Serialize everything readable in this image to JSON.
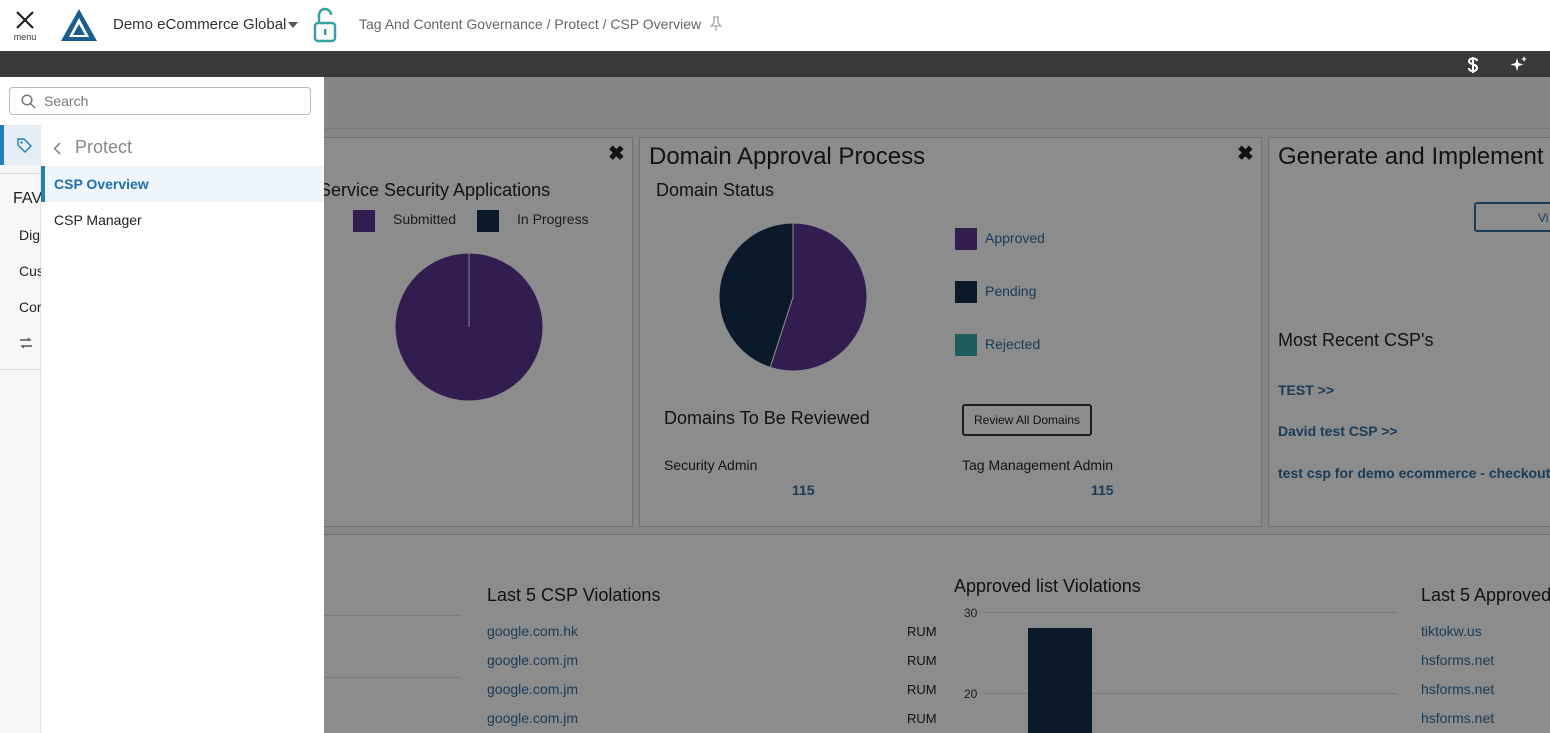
{
  "topbar": {
    "menu_label": "menu",
    "org_name": "Demo eCommerce Global",
    "breadcrumb": "Tag And Content Governance / Protect / CSP Overview"
  },
  "search": {
    "placeholder": "Search"
  },
  "sidebar": {
    "back_label": "Protect",
    "items": [
      {
        "label": "CSP Overview",
        "active": true
      },
      {
        "label": "CSP Manager",
        "active": false
      }
    ],
    "rail": {
      "fav_label": "FAV",
      "items": [
        "Digi",
        "Cus",
        "Cor"
      ]
    }
  },
  "cards": {
    "service": {
      "subtitle": "Service Security Applications",
      "legend": [
        {
          "label": "Submitted",
          "color": "#5b3492"
        },
        {
          "label": "In Progress",
          "color": "#15304f"
        }
      ]
    },
    "domain": {
      "title": "Domain Approval Process",
      "status_title": "Domain Status",
      "legend": [
        {
          "label": "Approved",
          "color": "#5b3492"
        },
        {
          "label": "Pending",
          "color": "#15304f"
        },
        {
          "label": "Rejected",
          "color": "#3aa8a8"
        }
      ],
      "review_title": "Domains To Be Reviewed",
      "review_button": "Review All Domains",
      "security_admin_label": "Security Admin",
      "security_admin_count": "115",
      "tag_admin_label": "Tag Management Admin",
      "tag_admin_count": "115"
    },
    "generate": {
      "title": "Generate and Implement",
      "button_partial": "Vi",
      "recent_title": "Most Recent CSP's",
      "recent": [
        "TEST >>",
        "David test CSP >>",
        "test csp for demo ecommerce - checkout >>"
      ]
    }
  },
  "lower": {
    "csp_violations_title": "Last 5 CSP Violations",
    "csp_violations": [
      {
        "domain": "google.com.hk",
        "type": "RUM"
      },
      {
        "domain": "google.com.jm",
        "type": "RUM"
      },
      {
        "domain": "google.com.jm",
        "type": "RUM"
      },
      {
        "domain": "google.com.jm",
        "type": "RUM"
      }
    ],
    "approved_violations_title": "Approved list Violations",
    "approved_title": "Last 5 Approved",
    "approved": [
      "tiktokw.us",
      "hsforms.net",
      "hsforms.net",
      "hsforms.net"
    ]
  },
  "chart_data": [
    {
      "type": "pie",
      "title": "",
      "categories": [
        "Submitted",
        "In Progress"
      ],
      "values": [
        100,
        0
      ],
      "colors": [
        "#5b3492",
        "#15304f"
      ]
    },
    {
      "type": "pie",
      "title": "Domain Status",
      "categories": [
        "Approved",
        "Pending",
        "Rejected"
      ],
      "values": [
        55,
        45,
        0
      ],
      "colors": [
        "#5b3492",
        "#15304f",
        "#3aa8a8"
      ]
    },
    {
      "type": "bar",
      "title": "Approved list Violations",
      "categories": [
        ""
      ],
      "values": [
        28
      ],
      "y_ticks": [
        "30",
        "20"
      ],
      "color": "#15304f"
    }
  ]
}
